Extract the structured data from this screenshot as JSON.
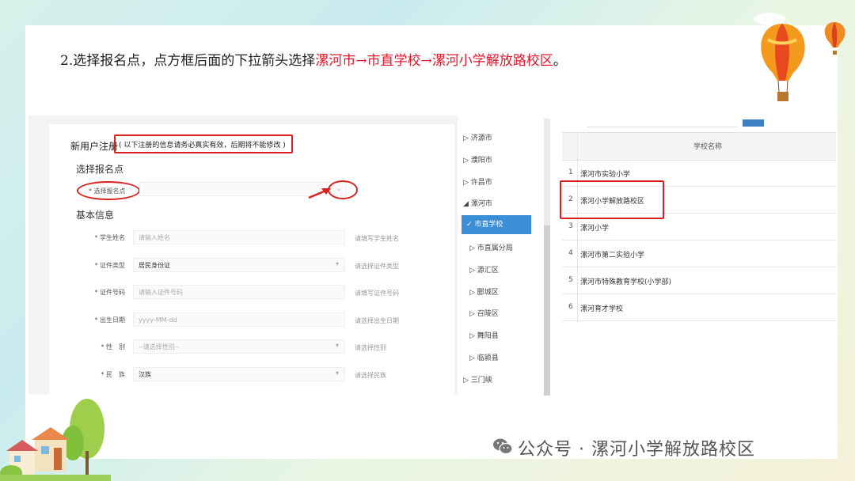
{
  "instruction": {
    "prefix": "2.选择报名点，点方框后面的下拉箭头选择",
    "highlight": "漯河市→市直学校→漯河小学解放路校区",
    "suffix": "。"
  },
  "form": {
    "title": "新用户注册",
    "notice": "( 以下注册的信息请务必真实有效，后期将不能修改 )",
    "section_signup": "选择报名点",
    "signup_label": "* 选择报名点",
    "dropdown_icon": "chevron-down-icon",
    "section_basic": "基本信息",
    "fields": [
      {
        "label": "* 学生姓名",
        "value": "请输入姓名",
        "hint": "请填写学生姓名",
        "filled": false,
        "dropdown": false
      },
      {
        "label": "* 证件类型",
        "value": "居民身份证",
        "hint": "请选择证件类型",
        "filled": true,
        "dropdown": true
      },
      {
        "label": "* 证件号码",
        "value": "请输入证件号码",
        "hint": "请填写证件号码",
        "filled": false,
        "dropdown": false
      },
      {
        "label": "* 出生日期",
        "value": "yyyy-MM-dd",
        "hint": "请选择出生日期",
        "filled": false,
        "dropdown": false
      },
      {
        "label": "* 性　别",
        "value": "--请选择性别--",
        "hint": "请选择性别",
        "filled": false,
        "dropdown": true
      },
      {
        "label": "* 民　族",
        "value": "汉族",
        "hint": "请选择民族",
        "filled": true,
        "dropdown": true
      }
    ]
  },
  "tree": {
    "items": [
      {
        "label": "▷ 济源市"
      },
      {
        "label": "▷ 濮阳市"
      },
      {
        "label": "▷ 许昌市"
      },
      {
        "label": "◢ 漯河市"
      },
      {
        "label": "✓ 市直学校"
      },
      {
        "label": "▷ 市直属分局"
      },
      {
        "label": "▷ 源汇区"
      },
      {
        "label": "▷ 郾城区"
      },
      {
        "label": "▷ 召陵区"
      },
      {
        "label": "▷ 舞阳县"
      },
      {
        "label": "▷ 临颍县"
      },
      {
        "label": "▷ 三门峡"
      }
    ]
  },
  "school_table": {
    "header": "学校名称",
    "rows": [
      {
        "num": "1",
        "name": "漯河市实验小学"
      },
      {
        "num": "2",
        "name": "漯河小学解放路校区"
      },
      {
        "num": "3",
        "name": "漯河小学"
      },
      {
        "num": "4",
        "name": "漯河市第二实验小学"
      },
      {
        "num": "5",
        "name": "漯河市特殊教育学校(小学部)"
      },
      {
        "num": "6",
        "name": "漯河育才学校"
      }
    ]
  },
  "footer": {
    "icon": "wechat-icon",
    "text": "公众号 · 漯河小学解放路校区"
  },
  "colors": {
    "highlight_red": "#e0182e",
    "annotation_red": "#d92020",
    "selected_blue": "#3a8fd6"
  }
}
